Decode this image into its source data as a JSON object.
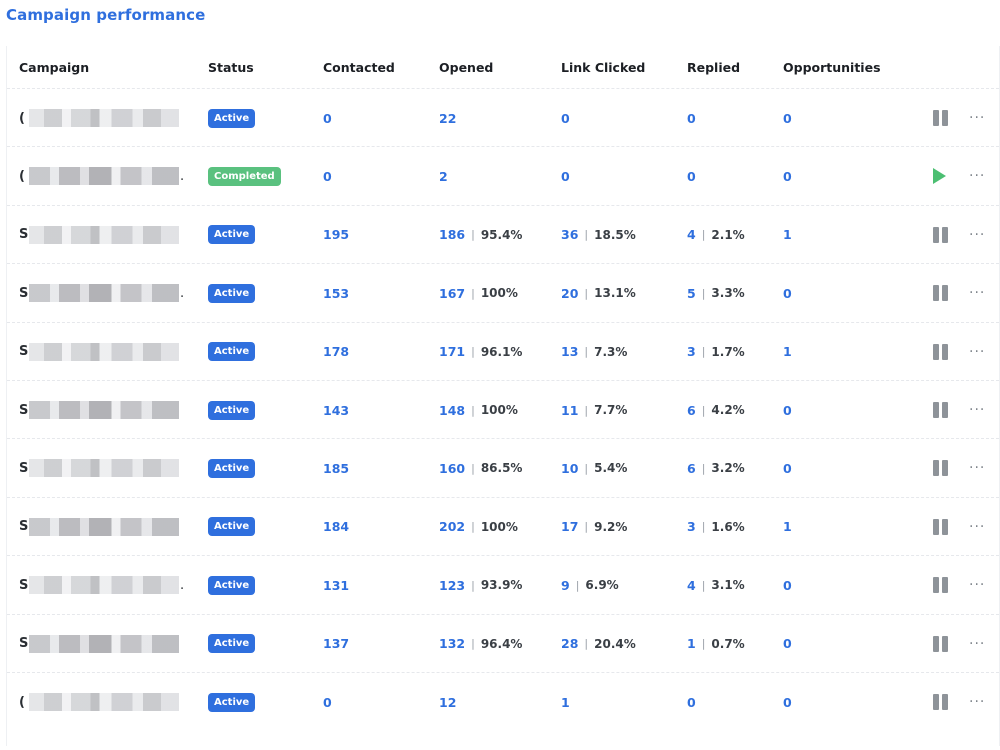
{
  "title": "Campaign performance",
  "columns": {
    "campaign": "Campaign",
    "status": "Status",
    "contacted": "Contacted",
    "opened": "Opened",
    "link_clicked": "Link Clicked",
    "replied": "Replied",
    "opportunities": "Opportunities"
  },
  "colors": {
    "accent": "#2f6fde",
    "active_badge": "#2f6fde",
    "completed_badge": "#5ac17f",
    "pause_icon": "#8e9399",
    "play_icon": "#4cbf72"
  },
  "rows": [
    {
      "lead": "(",
      "trail": "",
      "status": "Active",
      "contacted": "0",
      "opened": "22",
      "opened_pct": "",
      "clicked": "0",
      "clicked_pct": "",
      "replied": "0",
      "replied_pct": "",
      "opportunities": "0",
      "action": "pause-icon"
    },
    {
      "lead": "(",
      "trail": ".",
      "status": "Completed",
      "contacted": "0",
      "opened": "2",
      "opened_pct": "",
      "clicked": "0",
      "clicked_pct": "",
      "replied": "0",
      "replied_pct": "",
      "opportunities": "0",
      "action": "play-icon"
    },
    {
      "lead": "S",
      "trail": "",
      "status": "Active",
      "contacted": "195",
      "opened": "186",
      "opened_pct": "95.4%",
      "clicked": "36",
      "clicked_pct": "18.5%",
      "replied": "4",
      "replied_pct": "2.1%",
      "opportunities": "1",
      "action": "pause-icon"
    },
    {
      "lead": "S",
      "trail": ".",
      "status": "Active",
      "contacted": "153",
      "opened": "167",
      "opened_pct": "100%",
      "clicked": "20",
      "clicked_pct": "13.1%",
      "replied": "5",
      "replied_pct": "3.3%",
      "opportunities": "0",
      "action": "pause-icon"
    },
    {
      "lead": "S",
      "trail": "",
      "status": "Active",
      "contacted": "178",
      "opened": "171",
      "opened_pct": "96.1%",
      "clicked": "13",
      "clicked_pct": "7.3%",
      "replied": "3",
      "replied_pct": "1.7%",
      "opportunities": "1",
      "action": "pause-icon"
    },
    {
      "lead": "S",
      "trail": "",
      "status": "Active",
      "contacted": "143",
      "opened": "148",
      "opened_pct": "100%",
      "clicked": "11",
      "clicked_pct": "7.7%",
      "replied": "6",
      "replied_pct": "4.2%",
      "opportunities": "0",
      "action": "pause-icon"
    },
    {
      "lead": "S",
      "trail": "",
      "status": "Active",
      "contacted": "185",
      "opened": "160",
      "opened_pct": "86.5%",
      "clicked": "10",
      "clicked_pct": "5.4%",
      "replied": "6",
      "replied_pct": "3.2%",
      "opportunities": "0",
      "action": "pause-icon"
    },
    {
      "lead": "S",
      "trail": "",
      "status": "Active",
      "contacted": "184",
      "opened": "202",
      "opened_pct": "100%",
      "clicked": "17",
      "clicked_pct": "9.2%",
      "replied": "3",
      "replied_pct": "1.6%",
      "opportunities": "1",
      "action": "pause-icon"
    },
    {
      "lead": "S",
      "trail": ".",
      "status": "Active",
      "contacted": "131",
      "opened": "123",
      "opened_pct": "93.9%",
      "clicked": "9",
      "clicked_pct": "6.9%",
      "replied": "4",
      "replied_pct": "3.1%",
      "opportunities": "0",
      "action": "pause-icon"
    },
    {
      "lead": "S",
      "trail": "",
      "status": "Active",
      "contacted": "137",
      "opened": "132",
      "opened_pct": "96.4%",
      "clicked": "28",
      "clicked_pct": "20.4%",
      "replied": "1",
      "replied_pct": "0.7%",
      "opportunities": "0",
      "action": "pause-icon"
    },
    {
      "lead": "(",
      "trail": "",
      "status": "Active",
      "contacted": "0",
      "opened": "12",
      "opened_pct": "",
      "clicked": "1",
      "clicked_pct": "",
      "replied": "0",
      "replied_pct": "",
      "opportunities": "0",
      "action": "pause-icon"
    }
  ]
}
